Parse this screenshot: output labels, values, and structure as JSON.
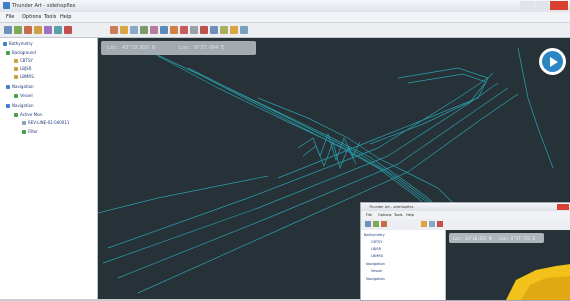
{
  "window": {
    "title": "Thunder Art - sidehopflex"
  },
  "menu": [
    "File",
    "Options",
    "Tools",
    "Help"
  ],
  "tree": [
    {
      "label": "Bathymetry",
      "kind": "group"
    },
    {
      "label": "Background",
      "kind": "group"
    },
    {
      "label": "CBTSY",
      "kind": "layer"
    },
    {
      "label": "LBJSR",
      "kind": "layer"
    },
    {
      "label": "LBMRS",
      "kind": "layer"
    },
    {
      "label": "Navigation",
      "kind": "group"
    },
    {
      "label": "Vessel",
      "kind": "layer"
    },
    {
      "label": "Navigation",
      "kind": "group"
    },
    {
      "label": "Active Mon.",
      "kind": "layer"
    },
    {
      "label": "REV-LINE-02-040011",
      "kind": "layer"
    },
    {
      "label": "Filter",
      "kind": "layer"
    }
  ],
  "viewer": {
    "lat": "Lat: 43°10.656 N",
    "lon": "Lon: 9°37.064 E"
  },
  "inset": {
    "title": "Thunder Art - sidehopflex",
    "menu": [
      "File",
      "Options",
      "Tools",
      "Help"
    ],
    "tree": [
      "Bathymetry",
      "CBTSY",
      "LBJSR",
      "LBMRS",
      "Navigation",
      "Vessel",
      "Navigation"
    ],
    "lat": "Lat: 43°10.651 N",
    "lon": "Lon: 9°37.752 E"
  },
  "colors": {
    "viewer_bg": "#263237",
    "wireframe": "#2ab3c4",
    "accent": "#2c86c3",
    "highlight": "#f2c21b"
  },
  "icons": [
    "app-icon",
    "play-icon",
    "folder-icon",
    "layer-icon",
    "toggle-icon"
  ]
}
